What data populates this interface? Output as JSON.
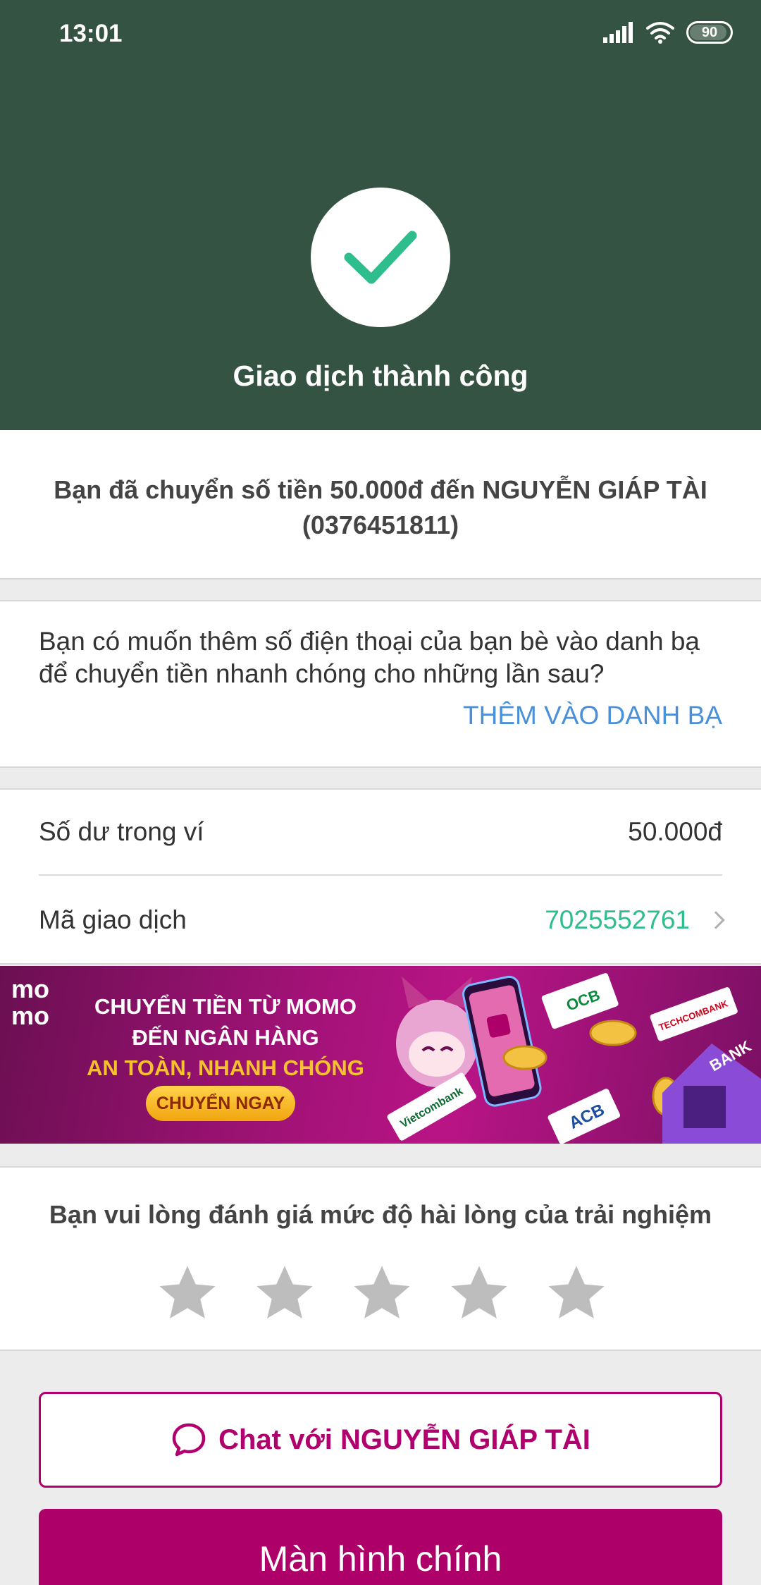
{
  "status_bar": {
    "time": "13:01",
    "battery": "90"
  },
  "header": {
    "title": "Giao dịch thành công"
  },
  "message": {
    "text": "Bạn đã chuyển số tiền 50.000đ đến NGUYỄN GIÁP TÀI (0376451811)"
  },
  "contact_prompt": {
    "text": "Bạn có muốn thêm số điện thoại của bạn bè vào danh bạ để chuyển tiền nhanh chóng cho những lần sau?",
    "action_label": "THÊM VÀO DANH BẠ"
  },
  "info": {
    "balance_label": "Số dư trong ví",
    "balance_value": "50.000đ",
    "txid_label": "Mã giao dịch",
    "txid_value": "7025552761"
  },
  "banner": {
    "logo_top": "mo",
    "logo_bottom": "mo",
    "line1": "CHUYỂN TIỀN TỪ MOMO",
    "line2": "ĐẾN NGÂN HÀNG",
    "line3": "AN TOÀN, NHANH CHÓNG",
    "cta": "CHUYỂN NGAY",
    "bank_labels": [
      "OCB",
      "TECHCOMBANK",
      "Vietcombank",
      "ACB",
      "BANK"
    ]
  },
  "rating": {
    "title": "Bạn vui lòng đánh giá mức độ hài lòng của trải nghiệm",
    "stars": 5,
    "selected": 0
  },
  "buttons": {
    "chat_label": "Chat với NGUYỄN GIÁP TÀI",
    "home_label": "Màn hình chính"
  },
  "colors": {
    "header_bg": "#355342",
    "accent_green": "#2ebd8c",
    "link_blue": "#4a90d9",
    "brand_magenta": "#ad0068"
  }
}
